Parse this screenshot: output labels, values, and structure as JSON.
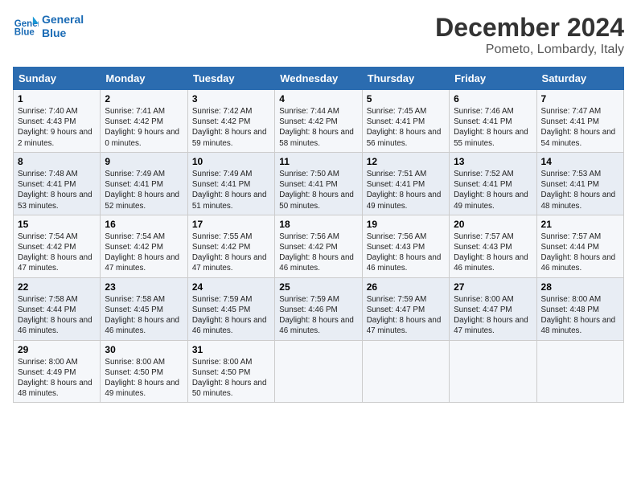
{
  "header": {
    "logo_line1": "General",
    "logo_line2": "Blue",
    "month": "December 2024",
    "location": "Pometo, Lombardy, Italy"
  },
  "weekdays": [
    "Sunday",
    "Monday",
    "Tuesday",
    "Wednesday",
    "Thursday",
    "Friday",
    "Saturday"
  ],
  "weeks": [
    [
      {
        "day": "1",
        "sunrise": "7:40 AM",
        "sunset": "4:43 PM",
        "daylight": "9 hours and 2 minutes."
      },
      {
        "day": "2",
        "sunrise": "7:41 AM",
        "sunset": "4:42 PM",
        "daylight": "9 hours and 0 minutes."
      },
      {
        "day": "3",
        "sunrise": "7:42 AM",
        "sunset": "4:42 PM",
        "daylight": "8 hours and 59 minutes."
      },
      {
        "day": "4",
        "sunrise": "7:44 AM",
        "sunset": "4:42 PM",
        "daylight": "8 hours and 58 minutes."
      },
      {
        "day": "5",
        "sunrise": "7:45 AM",
        "sunset": "4:41 PM",
        "daylight": "8 hours and 56 minutes."
      },
      {
        "day": "6",
        "sunrise": "7:46 AM",
        "sunset": "4:41 PM",
        "daylight": "8 hours and 55 minutes."
      },
      {
        "day": "7",
        "sunrise": "7:47 AM",
        "sunset": "4:41 PM",
        "daylight": "8 hours and 54 minutes."
      }
    ],
    [
      {
        "day": "8",
        "sunrise": "7:48 AM",
        "sunset": "4:41 PM",
        "daylight": "8 hours and 53 minutes."
      },
      {
        "day": "9",
        "sunrise": "7:49 AM",
        "sunset": "4:41 PM",
        "daylight": "8 hours and 52 minutes."
      },
      {
        "day": "10",
        "sunrise": "7:49 AM",
        "sunset": "4:41 PM",
        "daylight": "8 hours and 51 minutes."
      },
      {
        "day": "11",
        "sunrise": "7:50 AM",
        "sunset": "4:41 PM",
        "daylight": "8 hours and 50 minutes."
      },
      {
        "day": "12",
        "sunrise": "7:51 AM",
        "sunset": "4:41 PM",
        "daylight": "8 hours and 49 minutes."
      },
      {
        "day": "13",
        "sunrise": "7:52 AM",
        "sunset": "4:41 PM",
        "daylight": "8 hours and 49 minutes."
      },
      {
        "day": "14",
        "sunrise": "7:53 AM",
        "sunset": "4:41 PM",
        "daylight": "8 hours and 48 minutes."
      }
    ],
    [
      {
        "day": "15",
        "sunrise": "7:54 AM",
        "sunset": "4:42 PM",
        "daylight": "8 hours and 47 minutes."
      },
      {
        "day": "16",
        "sunrise": "7:54 AM",
        "sunset": "4:42 PM",
        "daylight": "8 hours and 47 minutes."
      },
      {
        "day": "17",
        "sunrise": "7:55 AM",
        "sunset": "4:42 PM",
        "daylight": "8 hours and 47 minutes."
      },
      {
        "day": "18",
        "sunrise": "7:56 AM",
        "sunset": "4:42 PM",
        "daylight": "8 hours and 46 minutes."
      },
      {
        "day": "19",
        "sunrise": "7:56 AM",
        "sunset": "4:43 PM",
        "daylight": "8 hours and 46 minutes."
      },
      {
        "day": "20",
        "sunrise": "7:57 AM",
        "sunset": "4:43 PM",
        "daylight": "8 hours and 46 minutes."
      },
      {
        "day": "21",
        "sunrise": "7:57 AM",
        "sunset": "4:44 PM",
        "daylight": "8 hours and 46 minutes."
      }
    ],
    [
      {
        "day": "22",
        "sunrise": "7:58 AM",
        "sunset": "4:44 PM",
        "daylight": "8 hours and 46 minutes."
      },
      {
        "day": "23",
        "sunrise": "7:58 AM",
        "sunset": "4:45 PM",
        "daylight": "8 hours and 46 minutes."
      },
      {
        "day": "24",
        "sunrise": "7:59 AM",
        "sunset": "4:45 PM",
        "daylight": "8 hours and 46 minutes."
      },
      {
        "day": "25",
        "sunrise": "7:59 AM",
        "sunset": "4:46 PM",
        "daylight": "8 hours and 46 minutes."
      },
      {
        "day": "26",
        "sunrise": "7:59 AM",
        "sunset": "4:47 PM",
        "daylight": "8 hours and 47 minutes."
      },
      {
        "day": "27",
        "sunrise": "8:00 AM",
        "sunset": "4:47 PM",
        "daylight": "8 hours and 47 minutes."
      },
      {
        "day": "28",
        "sunrise": "8:00 AM",
        "sunset": "4:48 PM",
        "daylight": "8 hours and 48 minutes."
      }
    ],
    [
      {
        "day": "29",
        "sunrise": "8:00 AM",
        "sunset": "4:49 PM",
        "daylight": "8 hours and 48 minutes."
      },
      {
        "day": "30",
        "sunrise": "8:00 AM",
        "sunset": "4:50 PM",
        "daylight": "8 hours and 49 minutes."
      },
      {
        "day": "31",
        "sunrise": "8:00 AM",
        "sunset": "4:50 PM",
        "daylight": "8 hours and 50 minutes."
      },
      null,
      null,
      null,
      null
    ]
  ],
  "labels": {
    "sunrise": "Sunrise:",
    "sunset": "Sunset:",
    "daylight": "Daylight:"
  }
}
